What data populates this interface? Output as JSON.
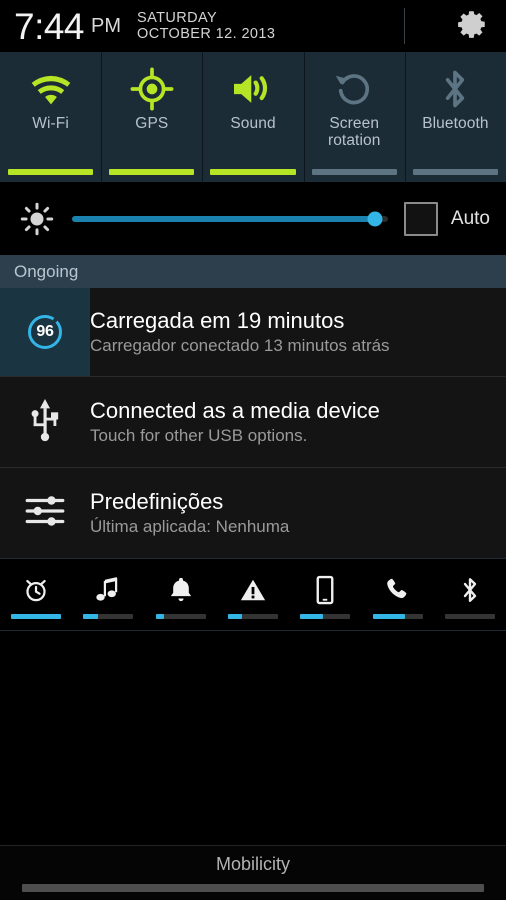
{
  "statusbar": {
    "time": "7:44",
    "ampm": "PM",
    "day": "SATURDAY",
    "date": "OCTOBER 12. 2013",
    "settings_icon": "gear-icon"
  },
  "quick_toggles": [
    {
      "label": "Wi-Fi",
      "icon": "wifi-icon",
      "state": "on",
      "underline_color": "#b5e524"
    },
    {
      "label": "GPS",
      "icon": "gps-icon",
      "state": "on",
      "underline_color": "#b5e524"
    },
    {
      "label": "Sound",
      "icon": "volume-speaker-icon",
      "state": "on",
      "underline_color": "#b5e524"
    },
    {
      "label": "Screen\nrotation",
      "icon": "rotate-icon",
      "state": "off",
      "underline_color": "#5d7483"
    },
    {
      "label": "Bluetooth",
      "icon": "bluetooth-icon",
      "state": "off",
      "underline_color": "#5d7483"
    }
  ],
  "brightness": {
    "icon": "brightness-sun-icon",
    "value_percent": 96,
    "track_color": "#1b81ae",
    "thumb_color": "#33b5e5",
    "auto_label": "Auto",
    "auto_checked": false
  },
  "sections": [
    {
      "header": "Ongoing"
    }
  ],
  "notifications": [
    {
      "id": "battery",
      "icon": "battery-ring-icon",
      "badge_value": "96",
      "title": "Carregada em 19 minutos",
      "subtitle": "Carregador conectado 13 minutos atrás",
      "accent_color": "#33b5e5"
    },
    {
      "id": "usb",
      "icon": "usb-icon",
      "title": "Connected as a media device",
      "subtitle": "Touch for other USB options."
    },
    {
      "id": "presets",
      "icon": "sliders-icon",
      "title": "Predefinições",
      "subtitle": "Última aplicada: Nenhuma"
    }
  ],
  "volume_sliders": [
    {
      "name": "alarm",
      "icon": "alarm-clock-icon",
      "value_percent": 100
    },
    {
      "name": "music",
      "icon": "music-note-icon",
      "value_percent": 30
    },
    {
      "name": "notification",
      "icon": "bell-icon",
      "value_percent": 16
    },
    {
      "name": "alert",
      "icon": "warning-icon",
      "value_percent": 28
    },
    {
      "name": "system",
      "icon": "phone-device-icon",
      "value_percent": 45
    },
    {
      "name": "call",
      "icon": "phone-handset-icon",
      "value_percent": 65
    },
    {
      "name": "bluetooth",
      "icon": "bluetooth-icon",
      "value_percent": 0
    }
  ],
  "footer": {
    "carrier": "Mobilicity"
  }
}
